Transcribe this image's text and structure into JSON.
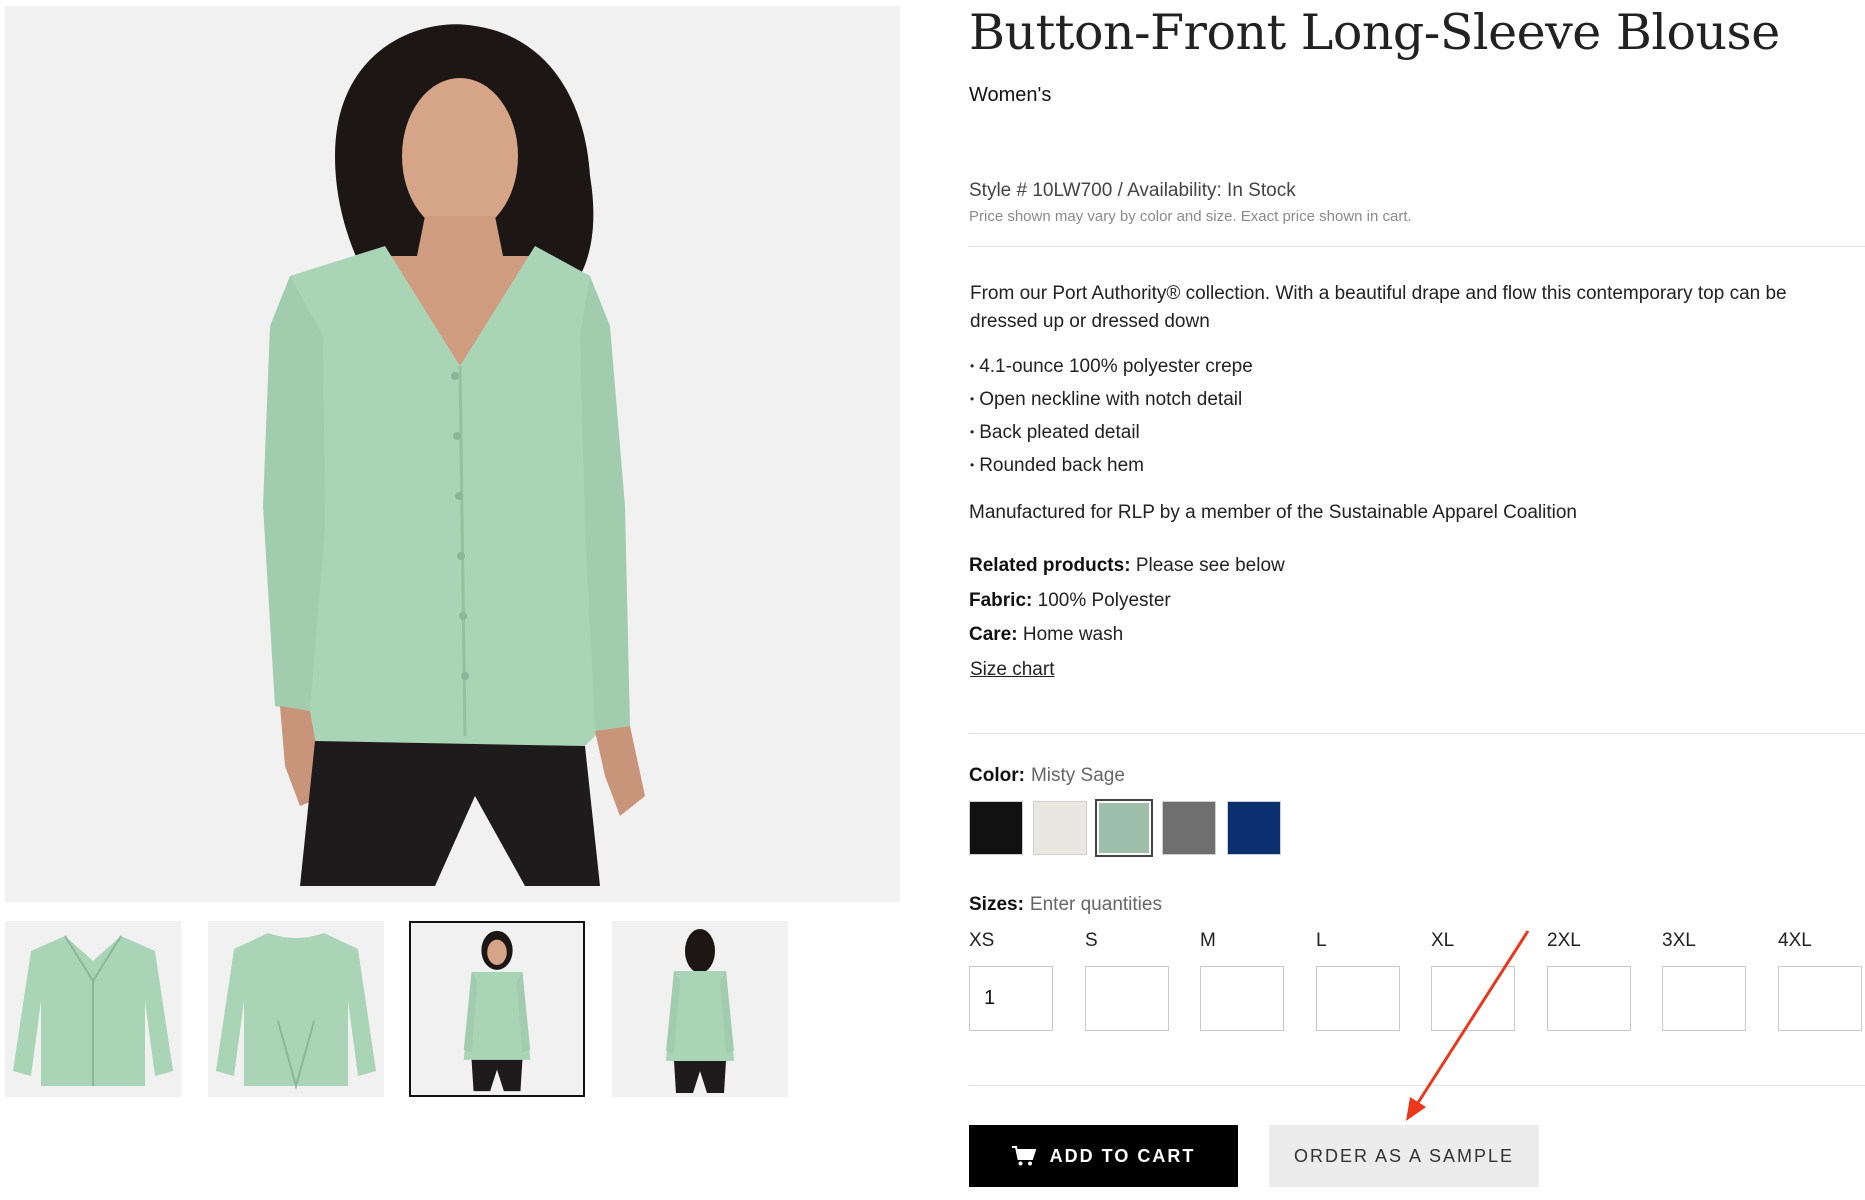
{
  "product": {
    "title": "Button-Front Long-Sleeve Blouse",
    "subtitle": "Women's",
    "style_line": "Style # 10LW700 / Availability: In Stock",
    "price_note": "Price shown may vary by color and size. Exact price shown in cart.",
    "description": "From our Port Authority® collection. With a beautiful drape and flow this contemporary top can be dressed up or dressed down",
    "bullets": [
      "4.1-ounce 100% polyester crepe",
      "Open neckline with notch detail",
      "Back pleated detail",
      "Rounded back hem"
    ],
    "manufactured": "Manufactured for RLP by a member of the Sustainable Apparel Coalition",
    "specs": {
      "related_label": "Related products:",
      "related_value": "Please see below",
      "fabric_label": "Fabric:",
      "fabric_value": "100% Polyester",
      "care_label": "Care:",
      "care_value": "Home wash"
    },
    "size_chart_link": "Size chart"
  },
  "color": {
    "label": "Color:",
    "selected": "Misty Sage",
    "swatches": [
      {
        "name": "black",
        "hex": "#111111"
      },
      {
        "name": "ivory",
        "hex": "#e9e7e2"
      },
      {
        "name": "misty-sage",
        "hex": "#9dbfac"
      },
      {
        "name": "grey",
        "hex": "#6f6f6f"
      },
      {
        "name": "navy",
        "hex": "#0b2f6e"
      }
    ]
  },
  "sizes": {
    "label": "Sizes:",
    "hint": "Enter quantities",
    "items": [
      {
        "size": "XS",
        "qty": "1"
      },
      {
        "size": "S",
        "qty": ""
      },
      {
        "size": "M",
        "qty": ""
      },
      {
        "size": "L",
        "qty": ""
      },
      {
        "size": "XL",
        "qty": ""
      },
      {
        "size": "2XL",
        "qty": ""
      },
      {
        "size": "3XL",
        "qty": ""
      },
      {
        "size": "4XL",
        "qty": ""
      }
    ]
  },
  "actions": {
    "add_to_cart": "ADD TO CART",
    "order_sample": "ORDER AS A SAMPLE"
  },
  "colors": {
    "garment": "#a9d4b5",
    "accent_arrow": "#e8391d"
  }
}
